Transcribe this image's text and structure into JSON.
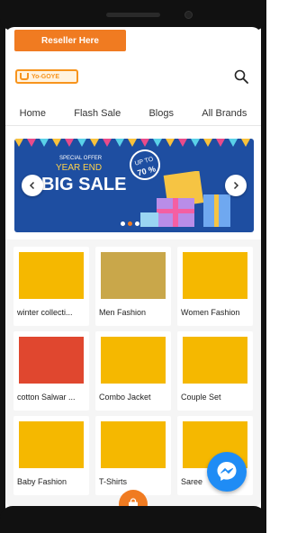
{
  "reseller": {
    "label": "Reseller Here"
  },
  "logo": {
    "text": "Yo-GOYE"
  },
  "nav": {
    "items": [
      "Home",
      "Flash Sale",
      "Blogs",
      "All Brands"
    ]
  },
  "banner": {
    "special": "SPECIAL OFFER",
    "year_end": "YEAR END",
    "big_sale": "BIG SALE",
    "badge_top": "UP TO",
    "badge_value": "70 %"
  },
  "categories": [
    {
      "label": "winter collecti..."
    },
    {
      "label": "Men Fashion"
    },
    {
      "label": "Women Fashion"
    },
    {
      "label": "cotton Salwar ..."
    },
    {
      "label": "Combo Jacket"
    },
    {
      "label": "Couple Set"
    },
    {
      "label": "Baby Fashion"
    },
    {
      "label": "T-Shirts"
    },
    {
      "label": "Saree"
    }
  ],
  "colors": {
    "accent": "#f07b21",
    "banner": "#1e4ea1",
    "card_bg": "#f5b800",
    "messenger": "#1f8cf5"
  },
  "icons": [
    "search-icon",
    "chevron-left-icon",
    "chevron-right-icon",
    "messenger-icon",
    "shopping-bag-icon"
  ]
}
